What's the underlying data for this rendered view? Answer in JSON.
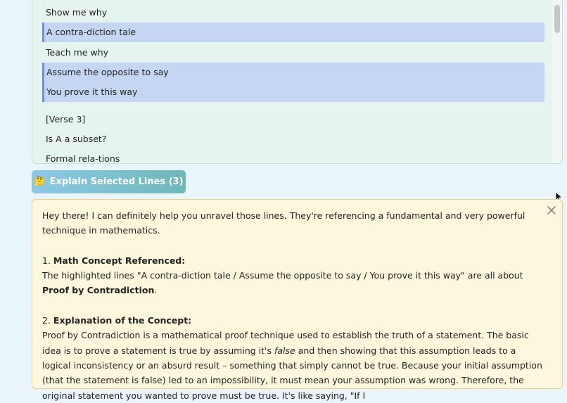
{
  "lyrics": {
    "lines": [
      {
        "text": "Show me why",
        "selected": false
      },
      {
        "text": "A contra-diction tale",
        "selected": true
      },
      {
        "text": "Teach me why",
        "selected": false
      },
      {
        "text": "Assume the opposite to say",
        "selected": true
      },
      {
        "text": "You prove it this way",
        "selected": true
      },
      {
        "text": "[Verse 3]",
        "selected": false
      },
      {
        "text": "Is A a subset?",
        "selected": false
      },
      {
        "text": "Formal rela-tions",
        "selected": false
      }
    ]
  },
  "explain_button": {
    "emoji": "🤔",
    "label": "Explain Selected Lines (3)"
  },
  "explanation": {
    "intro": "Hey there! I can definitely help you unravel those lines. They're referencing a fundamental and very powerful technique in mathematics.",
    "s1_num": "1.",
    "s1_heading": "Math Concept Referenced:",
    "s1_text_a": "The highlighted lines \"A contra-diction tale / Assume the opposite to say / You prove it this way\" are all about",
    "s1_bold": "Proof by Contradiction",
    "s1_end": ".",
    "s2_num": "2.",
    "s2_heading": "Explanation of the Concept:",
    "s2_text_a": "Proof by Contradiction is a mathematical proof technique used to establish the truth of a statement. The basic idea is to prove a statement is true by assuming it's",
    "s2_italic": "false",
    "s2_text_b": "and then showing that this assumption leads to a logical inconsistency or an absurd result – something that simply cannot be true. Because your initial assumption (that the statement is false) led to an impossibility, it must mean your assumption was wrong. Therefore, the original statement you wanted to prove must be true. It's like saying, \"If I"
  }
}
